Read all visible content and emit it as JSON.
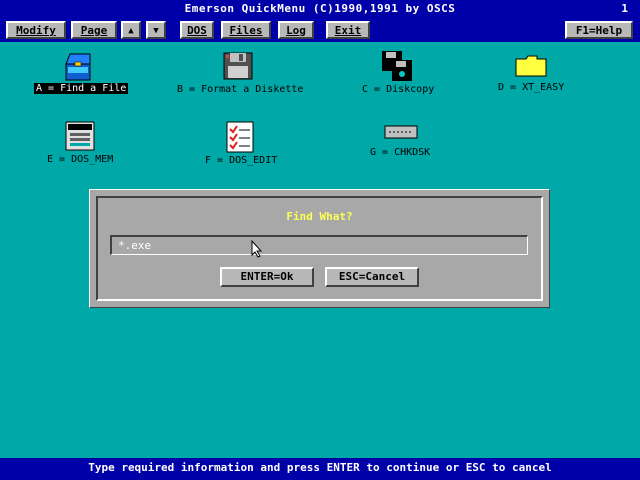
{
  "titlebar": {
    "title": "Emerson QuickMenu (C)1990,1991 by OSCS",
    "page_number": "1"
  },
  "toolbar": {
    "modify": "Modify",
    "page": "Page",
    "up": "▲",
    "down": "▼",
    "dos": "DOS",
    "files": "Files",
    "log": "Log",
    "exit": "Exit",
    "help": "F1=Help"
  },
  "icons": [
    {
      "label": "A = Find a File",
      "icon": "toolbox-icon"
    },
    {
      "label": "B = Format a Diskette",
      "icon": "floppy-disk-icon"
    },
    {
      "label": "C = Diskcopy",
      "icon": "diskcopy-icon"
    },
    {
      "label": "D = XT_EASY",
      "icon": "folder-icon"
    },
    {
      "label": "E = DOS_MEM",
      "icon": "memory-icon"
    },
    {
      "label": "F = DOS_EDIT",
      "icon": "checklist-icon"
    },
    {
      "label": "G = CHKDSK",
      "icon": "drive-icon"
    }
  ],
  "dialog": {
    "title": "Find What?",
    "value": "*.exe",
    "ok": "ENTER=Ok",
    "cancel": "ESC=Cancel"
  },
  "status": "Type required information and press ENTER to continue or ESC to cancel",
  "colors": {
    "desktop": "#00a8a8",
    "bars": "#0000a8",
    "dialog": "#a8a8a8",
    "dialog_title": "#ffff55"
  }
}
